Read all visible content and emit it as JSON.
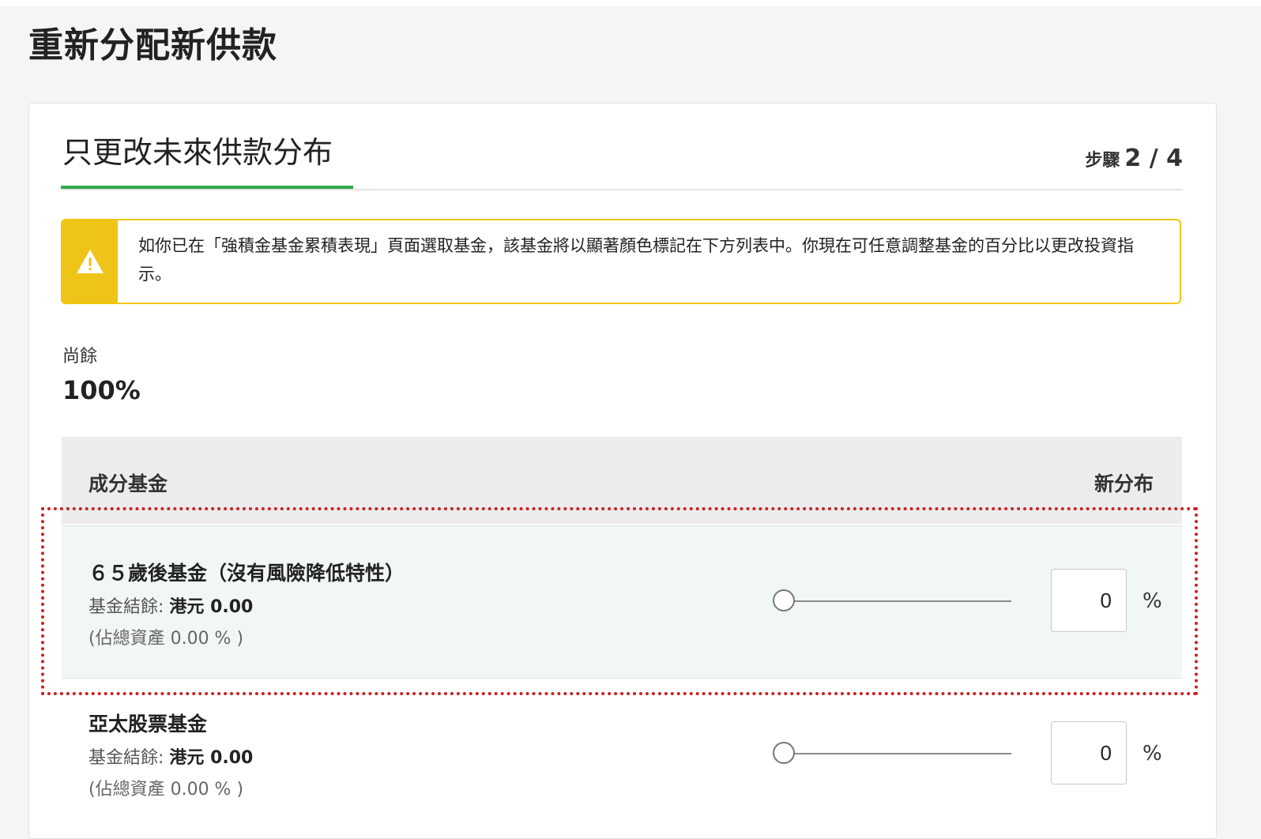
{
  "page": {
    "title": "重新分配新供款"
  },
  "step": {
    "section_title": "只更改未來供款分布",
    "step_word": "步驟",
    "step_value": "2 / 4"
  },
  "notice": {
    "icon": "warning-icon",
    "text": "如你已在「強積金基金累積表現」頁面選取基金，該基金將以顯著顏色標記在下方列表中。你現在可任意調整基金的百分比以更改投資指示。"
  },
  "remaining": {
    "label": "尚餘",
    "value": "100%"
  },
  "table": {
    "header_fund": "成分基金",
    "header_allocation": "新分布",
    "rows": [
      {
        "name": "６５歲後基金（沒有風險降低特性）",
        "balance_label": "基金結餘:",
        "balance_amount": "港元 0.00",
        "share": "(佔總資產 0.00 % )",
        "slider_value": 0,
        "percent": "0",
        "percent_sign": "%",
        "highlighted": true
      },
      {
        "name": "亞太股票基金",
        "balance_label": "基金結餘:",
        "balance_amount": "港元 0.00",
        "share": "(佔總資產 0.00 % )",
        "slider_value": 0,
        "percent": "0",
        "percent_sign": "%",
        "highlighted": false
      }
    ]
  },
  "colors": {
    "accent_green": "#2fa84f",
    "warning_yellow": "#efc419",
    "highlight_bg": "#f1f7f2",
    "annotation_red": "#cc1f1f"
  }
}
